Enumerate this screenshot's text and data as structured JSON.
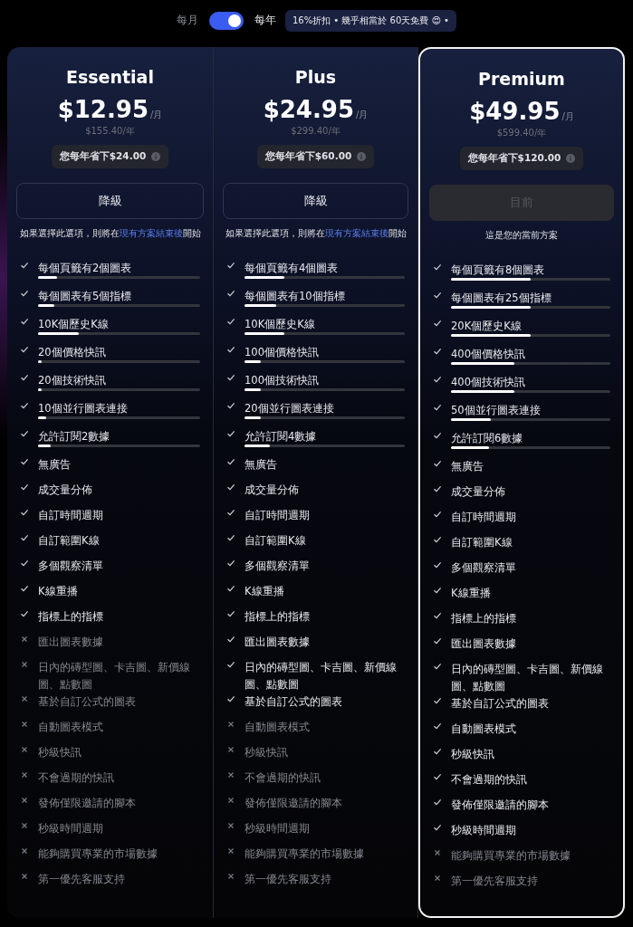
{
  "billing": {
    "monthly_label": "每月",
    "yearly_label": "每年",
    "yearly": true,
    "promo": "16%折扣 • 幾乎相當於 60天免費 😍 •"
  },
  "plans": [
    {
      "name": "Essential",
      "price": "$12.95",
      "per": "/月",
      "yearly_price": "$155.40/年",
      "savings": "您每年省下$24.00",
      "current": false,
      "button": {
        "label": "降級",
        "disabled": false
      },
      "note": {
        "text": "如果選擇此選項，則將在",
        "link": "現有方案結束後",
        "text_after": "開始"
      },
      "features": [
        {
          "text": "每個頁籤有2個圖表",
          "included": true,
          "level": 0.12
        },
        {
          "text": "每個圖表有5個指標",
          "included": true,
          "level": 0.1
        },
        {
          "text": "10K個歷史K線",
          "included": true,
          "level": 0.25
        },
        {
          "text": "20個價格快訊",
          "included": true,
          "level": 0.02
        },
        {
          "text": "20個技術快訊",
          "included": true,
          "level": 0.02
        },
        {
          "text": "10個並行圖表連接",
          "included": true,
          "level": 0.05
        },
        {
          "text": "允許訂閱2數據",
          "included": true,
          "level": 0.08
        },
        {
          "text": "無廣告",
          "included": true
        },
        {
          "text": "成交量分佈",
          "included": true
        },
        {
          "text": "自訂時間週期",
          "included": true
        },
        {
          "text": "自訂範圍K線",
          "included": true
        },
        {
          "text": "多個觀察清單",
          "included": true
        },
        {
          "text": "K線重播",
          "included": true
        },
        {
          "text": "指標上的指標",
          "included": true
        },
        {
          "text": "匯出圖表數據",
          "included": false
        },
        {
          "text": "日內的磚型圖、卡吉圖、新價線圖、點數圖",
          "included": false
        },
        {
          "text": "基於自訂公式的圖表",
          "included": false
        },
        {
          "text": "自動圖表模式",
          "included": false
        },
        {
          "text": "秒級快訊",
          "included": false
        },
        {
          "text": "不會過期的快訊",
          "included": false
        },
        {
          "text": "發佈僅限邀請的腳本",
          "included": false
        },
        {
          "text": "秒級時間週期",
          "included": false
        },
        {
          "text": "能夠購買專業的市場數據",
          "included": false
        },
        {
          "text": "第一優先客服支持",
          "included": false
        }
      ]
    },
    {
      "name": "Plus",
      "price": "$24.95",
      "per": "/月",
      "yearly_price": "$299.40/年",
      "savings": "您每年省下$60.00",
      "current": false,
      "button": {
        "label": "降級",
        "disabled": false
      },
      "note": {
        "text": "如果選擇此選項，則將在",
        "link": "現有方案結束後",
        "text_after": "開始"
      },
      "features": [
        {
          "text": "每個頁籤有4個圖表",
          "included": true,
          "level": 0.25
        },
        {
          "text": "每個圖表有10個指標",
          "included": true,
          "level": 0.2
        },
        {
          "text": "10K個歷史K線",
          "included": true,
          "level": 0.25
        },
        {
          "text": "100個價格快訊",
          "included": true,
          "level": 0.1
        },
        {
          "text": "100個技術快訊",
          "included": true,
          "level": 0.1
        },
        {
          "text": "20個並行圖表連接",
          "included": true,
          "level": 0.1
        },
        {
          "text": "允許訂閱4數據",
          "included": true,
          "level": 0.16
        },
        {
          "text": "無廣告",
          "included": true
        },
        {
          "text": "成交量分佈",
          "included": true
        },
        {
          "text": "自訂時間週期",
          "included": true
        },
        {
          "text": "自訂範圍K線",
          "included": true
        },
        {
          "text": "多個觀察清單",
          "included": true
        },
        {
          "text": "K線重播",
          "included": true
        },
        {
          "text": "指標上的指標",
          "included": true
        },
        {
          "text": "匯出圖表數據",
          "included": true
        },
        {
          "text": "日內的磚型圖、卡吉圖、新價線圖、點數圖",
          "included": true
        },
        {
          "text": "基於自訂公式的圖表",
          "included": true
        },
        {
          "text": "自動圖表模式",
          "included": false
        },
        {
          "text": "秒級快訊",
          "included": false
        },
        {
          "text": "不會過期的快訊",
          "included": false
        },
        {
          "text": "發佈僅限邀請的腳本",
          "included": false
        },
        {
          "text": "秒級時間週期",
          "included": false
        },
        {
          "text": "能夠購買專業的市場數據",
          "included": false
        },
        {
          "text": "第一優先客服支持",
          "included": false
        }
      ]
    },
    {
      "name": "Premium",
      "price": "$49.95",
      "per": "/月",
      "yearly_price": "$599.40/年",
      "savings": "您每年省下$120.00",
      "current": true,
      "button": {
        "label": "目前",
        "disabled": true
      },
      "note": {
        "text": "這是您的當前方案"
      },
      "features": [
        {
          "text": "每個頁籤有8個圖表",
          "included": true,
          "level": 0.5
        },
        {
          "text": "每個圖表有25個指標",
          "included": true,
          "level": 0.5
        },
        {
          "text": "20K個歷史K線",
          "included": true,
          "level": 0.5
        },
        {
          "text": "400個價格快訊",
          "included": true,
          "level": 0.4
        },
        {
          "text": "400個技術快訊",
          "included": true,
          "level": 0.4
        },
        {
          "text": "50個並行圖表連接",
          "included": true,
          "level": 0.25
        },
        {
          "text": "允許訂閱6數據",
          "included": true,
          "level": 0.24
        },
        {
          "text": "無廣告",
          "included": true
        },
        {
          "text": "成交量分佈",
          "included": true
        },
        {
          "text": "自訂時間週期",
          "included": true
        },
        {
          "text": "自訂範圍K線",
          "included": true
        },
        {
          "text": "多個觀察清單",
          "included": true
        },
        {
          "text": "K線重播",
          "included": true
        },
        {
          "text": "指標上的指標",
          "included": true
        },
        {
          "text": "匯出圖表數據",
          "included": true
        },
        {
          "text": "日內的磚型圖、卡吉圖、新價線圖、點數圖",
          "included": true
        },
        {
          "text": "基於自訂公式的圖表",
          "included": true
        },
        {
          "text": "自動圖表模式",
          "included": true
        },
        {
          "text": "秒級快訊",
          "included": true
        },
        {
          "text": "不會過期的快訊",
          "included": true
        },
        {
          "text": "發佈僅限邀請的腳本",
          "included": true
        },
        {
          "text": "秒級時間週期",
          "included": true
        },
        {
          "text": "能夠購買專業的市場數據",
          "included": false
        },
        {
          "text": "第一優先客服支持",
          "included": false
        }
      ]
    }
  ]
}
